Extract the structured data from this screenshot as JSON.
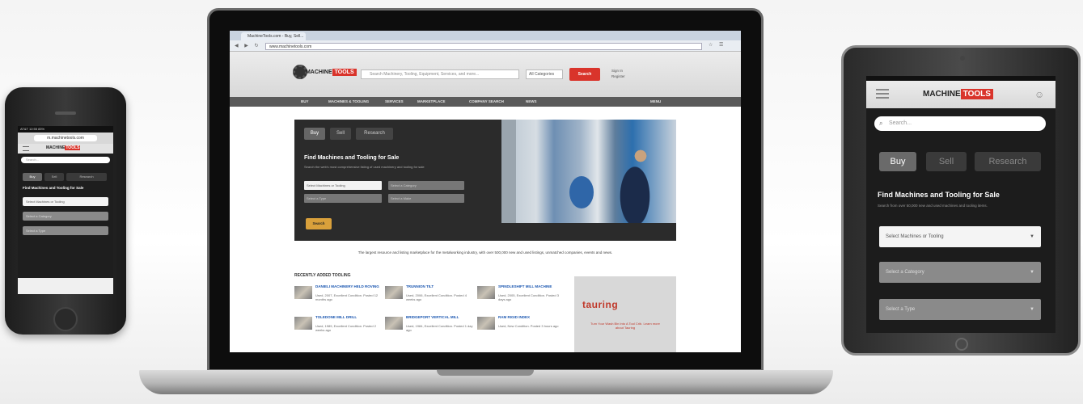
{
  "phone": {
    "status": "AT&T  12:55  83%",
    "url": "m.machinetools.com",
    "logo_a": "MACHINE",
    "logo_b": "TOOLS",
    "search_placeholder": "Search...",
    "tabs": [
      "Buy",
      "Sell",
      "Research"
    ],
    "headline": "Find Machines and Tooling for Sale",
    "selects": [
      "Select Machines or Tooling",
      "Select a Category",
      "Select a Type"
    ]
  },
  "laptop": {
    "browser": {
      "tab_title": "MachineTools.com - Buy, Sell...",
      "url": "www.machinetools.com",
      "nav_glyphs": "◀ ▶ ↻",
      "right_glyphs": "☆ ☰"
    },
    "site": {
      "logo_a": "MACHINE",
      "logo_b": "TOOLS",
      "search_placeholder": "Search Machinery, Tooling, Equipment, Services, and more...",
      "category": "All Categories",
      "search_button": "Search",
      "signin": [
        "Sign In",
        "Register"
      ],
      "nav": [
        "BUY",
        "MACHINES & TOOLING",
        "SERVICES",
        "MARKETPLACE",
        "COMPANY SEARCH",
        "NEWS",
        "MENU"
      ]
    },
    "hero": {
      "tabs": [
        "Buy",
        "Sell",
        "Research"
      ],
      "headline": "Find Machines and Tooling for Sale",
      "subline": "Search the web's most comprehensive listing of used machinery and tooling for sale",
      "selects": [
        "Select Machines or Tooling",
        "Select a Category",
        "Select a Type",
        "Select a Make"
      ],
      "go_button": "Search",
      "tagline": "The largest resource and listing marketplace for the metalworking industry, with over 500,000 new and used listings, unmatched companies, events and news."
    },
    "recent": {
      "title": "RECENTLY ADDED TOOLING",
      "listings": [
        {
          "title": "DANIELI MACHINERY HELD ROVING",
          "desc": "Used, 2007, Excellent Condition. Posted 12 months ago"
        },
        {
          "title": "TRUNNION TILT",
          "desc": "Used, 2006, Excellent Condition. Posted 4 weeks ago"
        },
        {
          "title": "SPINDLESHIFT MILL MACHINE",
          "desc": "Used, 2005, Excellent Condition. Posted 3 days ago"
        },
        {
          "title": "TOLEDONE MILL DRILL",
          "desc": "Used, 1989, Excellent Condition. Posted 2 weeks ago"
        },
        {
          "title": "BRIDGEPORT VERTICAL MILL",
          "desc": "Used, 1984, Excellent Condition. Posted 1 day ago"
        },
        {
          "title": "RAM RIGID INDEX",
          "desc": "Used, New Condition. Posted 3 hours ago"
        }
      ]
    },
    "ad": {
      "brand": "tauring",
      "text": "Turn Your Wash Bin Into A Tool Crib. Learn more about Tauring"
    }
  },
  "tablet": {
    "logo_a": "MACHINE",
    "logo_b": "TOOLS",
    "search_placeholder": "Search...",
    "search_icon": "⌕",
    "user_icon": "☺",
    "tabs": [
      "Buy",
      "Sell",
      "Research"
    ],
    "headline": "Find Machines and Tooling for Sale",
    "subline": "Search from over 50,000 new and used machines and tooling items.",
    "selects": [
      "Select Machines or Tooling",
      "Select a Category",
      "Select a Type"
    ]
  },
  "colors": {
    "brand_red": "#d9342b",
    "accent_gold": "#d9a03b",
    "link_blue": "#1a56b0"
  }
}
